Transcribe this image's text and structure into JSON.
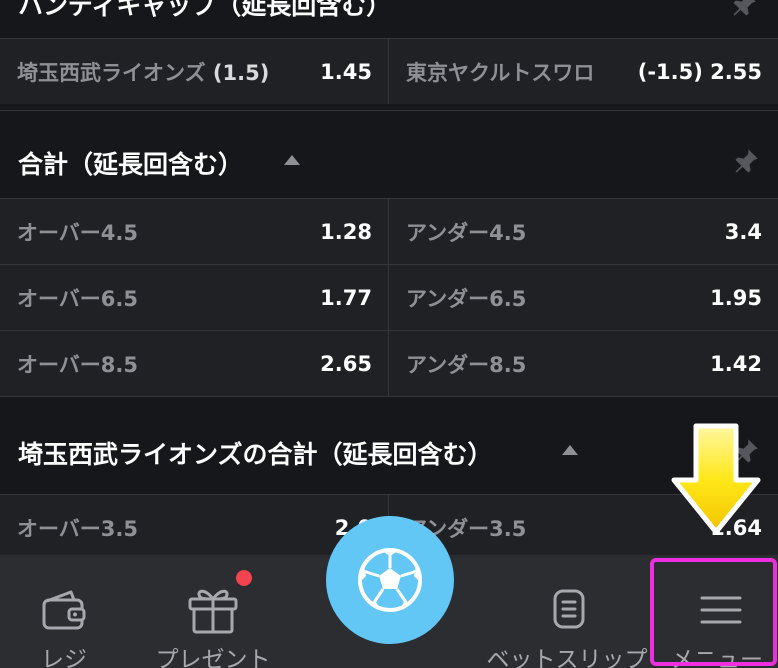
{
  "top_section": {
    "title": "ハンディキャップ（延長回含む）"
  },
  "handicap_row": {
    "left": {
      "team": "埼玉西武ライオンズ",
      "line": "(1.5)",
      "odds": "1.45"
    },
    "right": {
      "team": "東京ヤクルトスワロ",
      "line": "(-1.5)",
      "odds": "2.55"
    }
  },
  "total_section": {
    "title": "合計（延長回含む）",
    "rows": [
      {
        "left": {
          "label": "オーバー4.5",
          "odds": "1.28"
        },
        "right": {
          "label": "アンダー4.5",
          "odds": "3.4"
        }
      },
      {
        "left": {
          "label": "オーバー6.5",
          "odds": "1.77"
        },
        "right": {
          "label": "アンダー6.5",
          "odds": "1.95"
        }
      },
      {
        "left": {
          "label": "オーバー8.5",
          "odds": "2.65"
        },
        "right": {
          "label": "アンダー8.5",
          "odds": "1.42"
        }
      }
    ]
  },
  "team_total_section": {
    "title": "埼玉西武ライオンズの合計（延長回含む）",
    "rows": [
      {
        "left": {
          "label": "オーバー3.5",
          "odds": "2.0"
        },
        "right": {
          "label": "アンダー3.5",
          "odds": "1.64"
        }
      }
    ]
  },
  "bottom_nav": {
    "items": [
      {
        "label": "レジ",
        "icon": "wallet-icon"
      },
      {
        "label": "プレゼント",
        "icon": "gift-icon"
      },
      {
        "label": "",
        "icon": "soccer-ball-icon"
      },
      {
        "label": "ベットスリップ",
        "icon": "bet-slip-icon"
      },
      {
        "label": "メニュー",
        "icon": "hamburger-menu-icon"
      }
    ]
  },
  "colors": {
    "background": "#15171b",
    "row_background": "#1f2125",
    "nav_background": "#2b2d31",
    "accent_ball": "#63c7f6",
    "badge": "#f2444c",
    "highlight": "#ee2fe0",
    "arrow": "#ffe81a"
  }
}
